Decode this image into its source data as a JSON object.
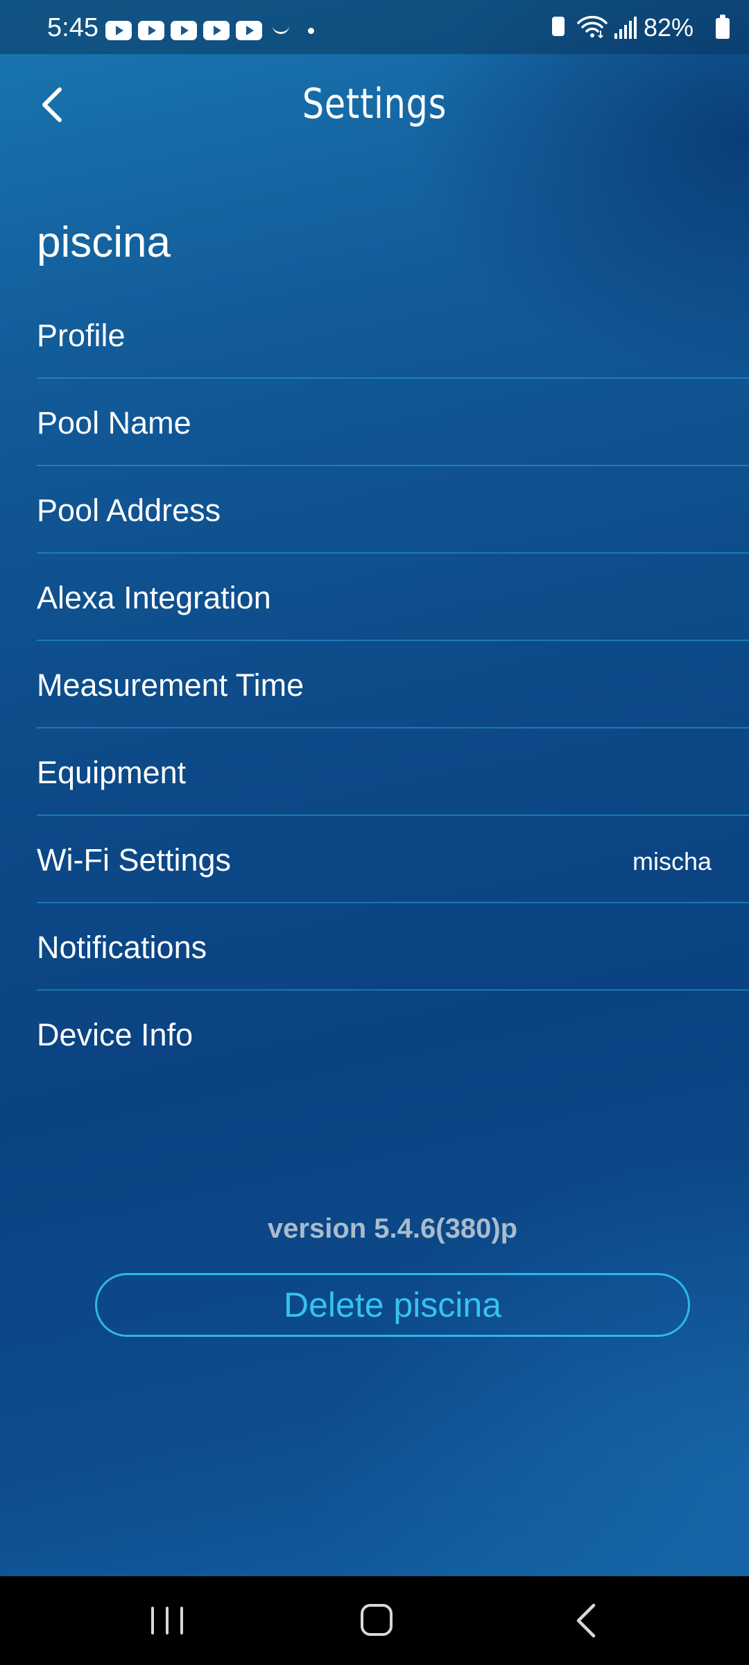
{
  "status_bar": {
    "time": "5:45",
    "battery_percent": "82%",
    "notification_icons": [
      "youtube-icon",
      "youtube-icon",
      "youtube-icon",
      "youtube-icon",
      "youtube-icon",
      "amazon-icon",
      "more-notifications-dot"
    ],
    "system_icons": [
      "battery-saver-icon",
      "wifi-icon",
      "signal-icon",
      "battery-icon"
    ]
  },
  "header": {
    "title": "Settings",
    "back_icon": "chevron-left-icon"
  },
  "pool": {
    "name": "piscina"
  },
  "settings": {
    "items": [
      {
        "label": "Profile",
        "value": ""
      },
      {
        "label": "Pool Name",
        "value": ""
      },
      {
        "label": "Pool Address",
        "value": ""
      },
      {
        "label": "Alexa Integration",
        "value": ""
      },
      {
        "label": "Measurement Time",
        "value": ""
      },
      {
        "label": "Equipment",
        "value": ""
      },
      {
        "label": "Wi-Fi Settings",
        "value": "mischa"
      },
      {
        "label": "Notifications",
        "value": ""
      },
      {
        "label": "Device Info",
        "value": ""
      }
    ]
  },
  "footer": {
    "version": "version 5.4.6(380)p",
    "delete_label": "Delete piscina"
  },
  "nav_bar": {
    "icons": [
      "recent-apps-icon",
      "home-icon",
      "back-icon"
    ]
  },
  "colors": {
    "background_top": "#1a78b2",
    "background_mid": "#0b4282",
    "divider": "#28a0dc",
    "accent": "#35c3ef",
    "version_text": "#a9bccd",
    "nav_bar": "#000000"
  }
}
